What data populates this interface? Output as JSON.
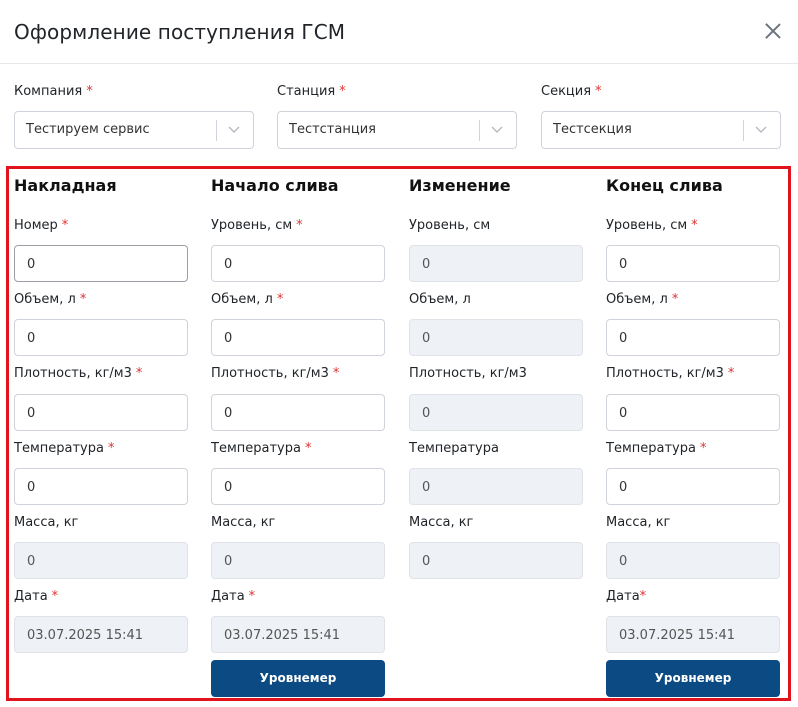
{
  "modal": {
    "title": "Оформление поступления ГСМ"
  },
  "selects": [
    {
      "label": "Компания",
      "value": "Тестируем сервис"
    },
    {
      "label": "Станция",
      "value": "Тестстанция"
    },
    {
      "label": "Секция",
      "value": "Тестсекция"
    }
  ],
  "required_mark": "*",
  "columns": [
    {
      "title": "Накладная",
      "fields": [
        {
          "label": "Номер",
          "value": "0"
        },
        {
          "label": "Объем, л",
          "value": "0"
        },
        {
          "label": "Плотность, кг/м3",
          "value": "0"
        },
        {
          "label": "Температура",
          "value": "0"
        },
        {
          "label": "Масса, кг",
          "value": "0"
        },
        {
          "label": "Дата",
          "value": "03.07.2025 15:41"
        }
      ]
    },
    {
      "title": "Начало слива",
      "fields": [
        {
          "label": "Уровень, см",
          "value": "0"
        },
        {
          "label": "Объем, л",
          "value": "0"
        },
        {
          "label": "Плотность, кг/м3",
          "value": "0"
        },
        {
          "label": "Температура",
          "value": "0"
        },
        {
          "label": "Масса, кг",
          "value": "0"
        },
        {
          "label": "Дата",
          "value": "03.07.2025 15:41"
        }
      ],
      "button": "Уровнемер"
    },
    {
      "title": "Изменение",
      "fields": [
        {
          "label": "Уровень, см",
          "value": "0"
        },
        {
          "label": "Объем, л",
          "value": "0"
        },
        {
          "label": "Плотность, кг/м3",
          "value": "0"
        },
        {
          "label": "Температура",
          "value": "0"
        },
        {
          "label": "Масса, кг",
          "value": "0"
        }
      ]
    },
    {
      "title": "Конец слива",
      "fields": [
        {
          "label": "Уровень, см",
          "value": "0"
        },
        {
          "label": "Объем, л",
          "value": "0"
        },
        {
          "label": "Плотность, кг/м3",
          "value": "0"
        },
        {
          "label": "Температура",
          "value": "0"
        },
        {
          "label": "Масса, кг",
          "value": "0"
        },
        {
          "label": "Дата",
          "value": "03.07.2025 15:41"
        }
      ],
      "button": "Уровнемер"
    }
  ],
  "colors": {
    "accent": "#0b4a82",
    "required": "#e03131",
    "highlight_frame": "#e1141e"
  }
}
